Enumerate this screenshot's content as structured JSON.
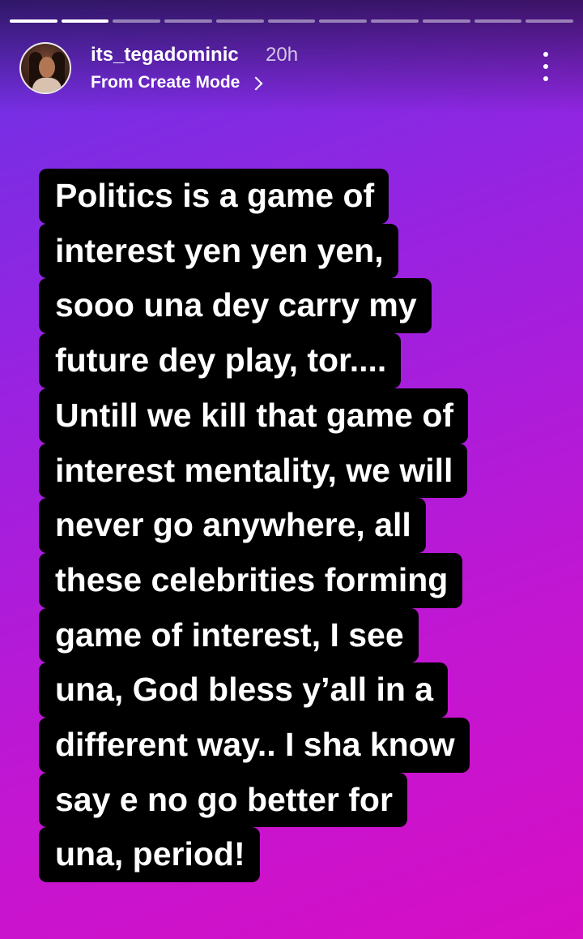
{
  "story": {
    "progress_segments": 11,
    "progress_done": 2,
    "username": "its_tegadominic",
    "time_ago": "20h",
    "source": "From Create Mode",
    "lines": [
      "Politics is a game of",
      "interest yen yen yen,",
      "sooo una dey carry my",
      "future dey play, tor....",
      "Untill we kill that game of",
      "interest mentality, we will",
      "never go anywhere, all",
      "these celebrities forming",
      "game of interest, I see",
      "una, God bless y’all in a",
      "different way.. I sha know",
      "say e no go better for",
      "una, period!"
    ]
  },
  "icons": {
    "more": "more-vertical-icon",
    "chevron": "chevron-right-icon"
  },
  "colors": {
    "gradient_start": "#6a33e6",
    "gradient_end": "#d60ec4",
    "text_background": "#000000",
    "text": "#ffffff"
  }
}
